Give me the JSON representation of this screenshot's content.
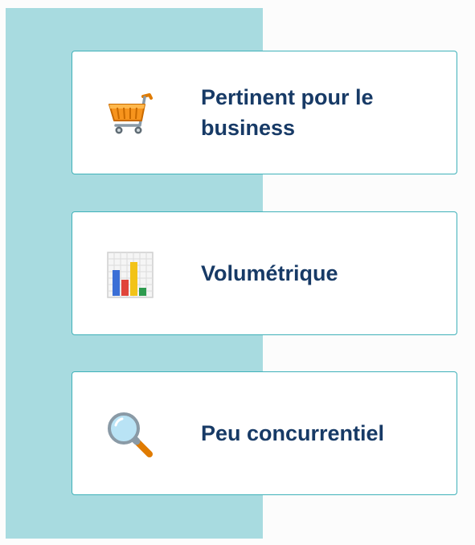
{
  "colors": {
    "panel": "#a8dbe0",
    "card_border": "#3fb1b9",
    "text": "#173a66"
  },
  "cards": [
    {
      "icon": "shopping-cart-icon",
      "label": "Pertinent pour le business"
    },
    {
      "icon": "bar-chart-icon",
      "label": "Volumétrique"
    },
    {
      "icon": "magnifying-glass-icon",
      "label": "Peu concurrentiel"
    }
  ]
}
